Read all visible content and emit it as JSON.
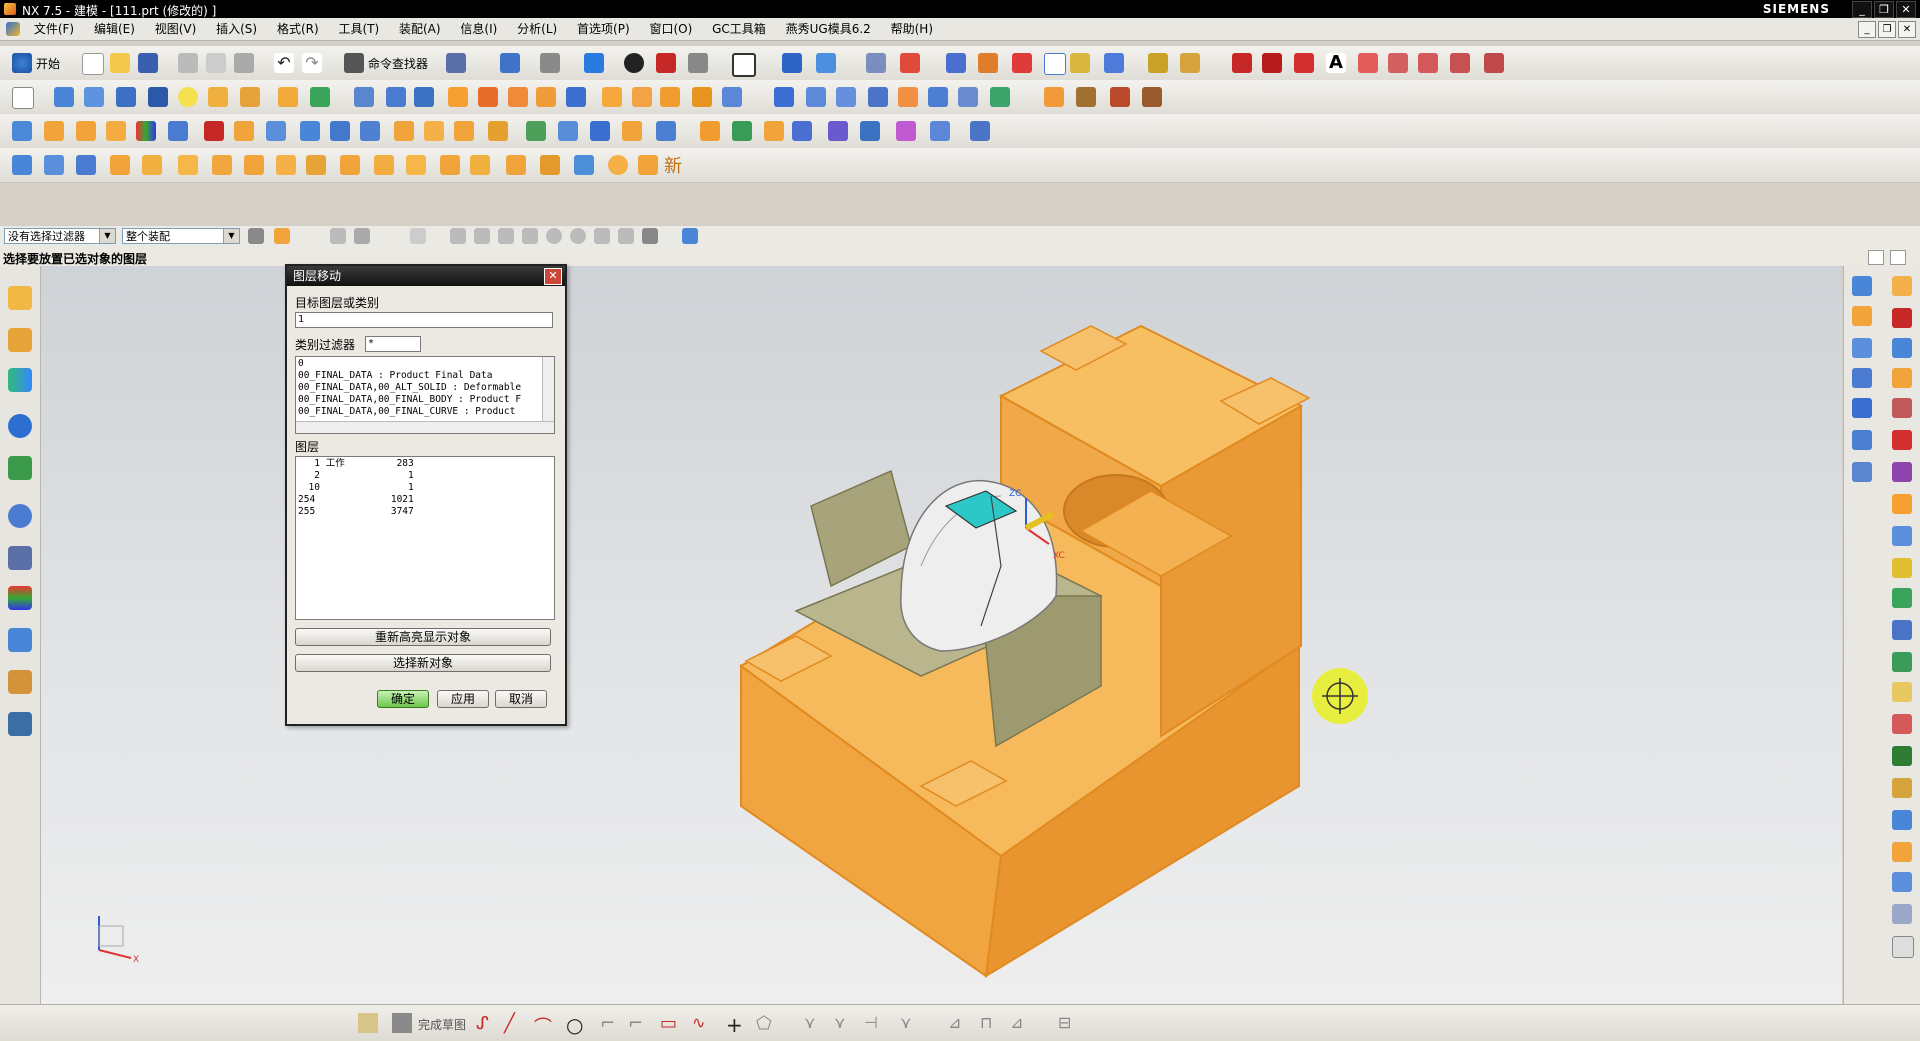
{
  "window": {
    "title": "NX 7.5 - 建模 - [111.prt (修改的) ]",
    "brand": "SIEMENS",
    "controls": [
      "_",
      "❐",
      "✕"
    ]
  },
  "menu": {
    "items": [
      "文件(F)",
      "编辑(E)",
      "视图(V)",
      "插入(S)",
      "格式(R)",
      "工具(T)",
      "装配(A)",
      "信息(I)",
      "分析(L)",
      "首选项(P)",
      "窗口(O)",
      "GC工具箱",
      "燕秀UG模具6.2",
      "帮助(H)"
    ]
  },
  "toolbar": {
    "start_label": "开始",
    "command_finder_label": "命令查找器",
    "new_label": "新"
  },
  "filters": {
    "type_filter": "没有选择过滤器",
    "assembly_filter": "整个装配"
  },
  "status": {
    "prompt": "选择要放置已选对象的图层"
  },
  "dialog": {
    "title": "图层移动",
    "target_label": "目标图层或类别",
    "target_value": "1",
    "category_filter_label": "类别过滤器",
    "category_filter_value": "*",
    "categories": [
      "0",
      "00_FINAL_DATA : Product Final Data",
      "00_FINAL_DATA,00_ALT_SOLID : Deformable",
      "00_FINAL_DATA,00_FINAL_BODY : Product F",
      "00_FINAL_DATA,00_FINAL_CURVE : Product"
    ],
    "layers_label": "图层",
    "layers": [
      {
        "layer": "1",
        "status": "工作",
        "count": "283"
      },
      {
        "layer": "2",
        "status": "",
        "count": "1"
      },
      {
        "layer": "10",
        "status": "",
        "count": "1"
      },
      {
        "layer": "254",
        "status": "",
        "count": "1021"
      },
      {
        "layer": "255",
        "status": "",
        "count": "3747"
      }
    ],
    "rehighlight_button": "重新高亮显示对象",
    "select_new_button": "选择新对象",
    "ok_button": "确定",
    "apply_button": "应用",
    "cancel_button": "取消"
  },
  "viewport": {
    "axis_labels": {
      "zc": "ZC",
      "xc": "XC",
      "x": "X"
    }
  },
  "sketch_bar": {
    "finish_label": "完成草图"
  },
  "colors": {
    "part_orange": "#f5b457",
    "part_edge": "#e08a20",
    "slider_olive": "#a7a37a",
    "cursor_yellow": "#e9f020"
  }
}
